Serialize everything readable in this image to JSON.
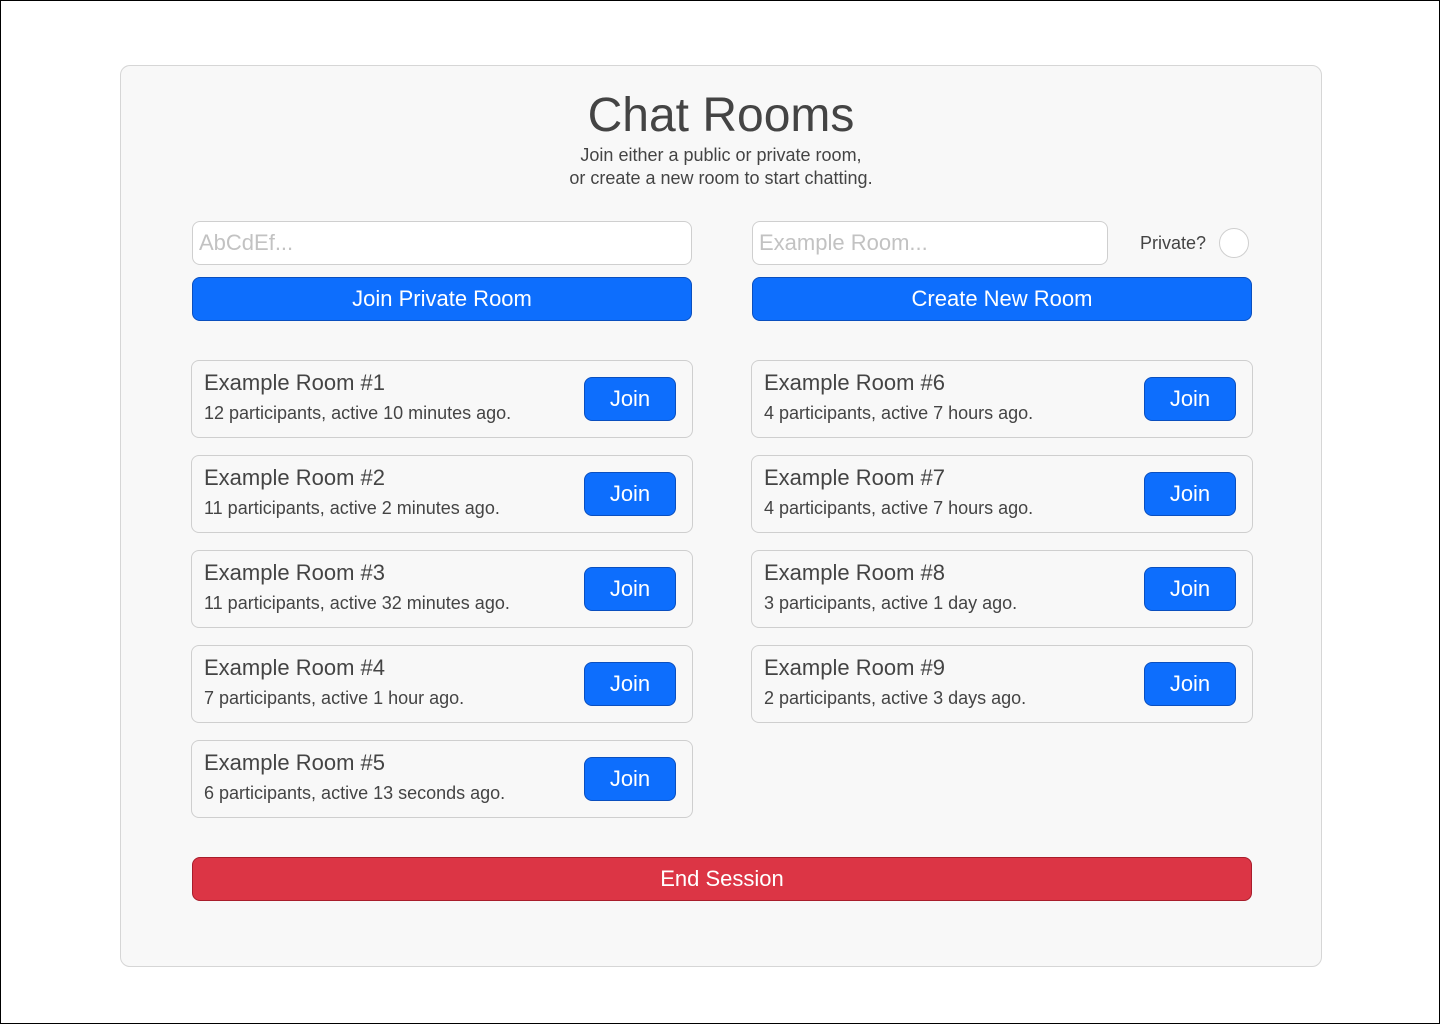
{
  "header": {
    "title": "Chat Rooms",
    "subtitle_line1": "Join either a public or private room,",
    "subtitle_line2": "or create a new room to start chatting."
  },
  "join_private": {
    "code_placeholder": "AbCdEf...",
    "code_value": "",
    "button_label": "Join Private Room"
  },
  "create_room": {
    "name_placeholder": "Example Room...",
    "name_value": "",
    "private_label": "Private?",
    "private_checked": false,
    "button_label": "Create New Room"
  },
  "rooms": [
    {
      "name": "Example Room #1",
      "meta": "12 participants, active 10 minutes ago.",
      "join_label": "Join"
    },
    {
      "name": "Example Room #2",
      "meta": "11 participants, active 2 minutes ago.",
      "join_label": "Join"
    },
    {
      "name": "Example Room #3",
      "meta": "11 participants, active 32 minutes ago.",
      "join_label": "Join"
    },
    {
      "name": "Example Room #4",
      "meta": "7 participants, active 1 hour ago.",
      "join_label": "Join"
    },
    {
      "name": "Example Room #5",
      "meta": "6 participants, active 13 seconds ago.",
      "join_label": "Join"
    },
    {
      "name": "Example Room #6",
      "meta": "4 participants, active 7 hours ago.",
      "join_label": "Join"
    },
    {
      "name": "Example Room #7",
      "meta": "4 participants, active 7 hours ago.",
      "join_label": "Join"
    },
    {
      "name": "Example Room #8",
      "meta": "3 participants, active 1 day ago.",
      "join_label": "Join"
    },
    {
      "name": "Example Room #9",
      "meta": "2 participants, active 3 days ago.",
      "join_label": "Join"
    }
  ],
  "footer": {
    "end_session_label": "End Session"
  },
  "colors": {
    "primary": "#0d6efd",
    "danger": "#dc3545",
    "panel_background": "#f8f8f8",
    "text": "#444444"
  }
}
